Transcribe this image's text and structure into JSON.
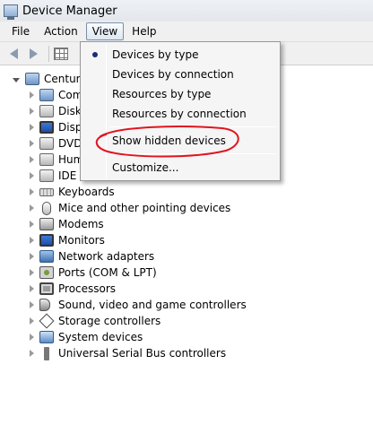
{
  "window": {
    "title": "Device Manager"
  },
  "menubar": {
    "items": [
      "File",
      "Action",
      "View",
      "Help"
    ]
  },
  "tree": {
    "root": "Centurio",
    "items": [
      "Com",
      "Disk",
      "Disp",
      "DVD",
      "Hum",
      "IDE A",
      "Keyboards",
      "Mice and other pointing devices",
      "Modems",
      "Monitors",
      "Network adapters",
      "Ports (COM & LPT)",
      "Processors",
      "Sound, video and game controllers",
      "Storage controllers",
      "System devices",
      "Universal Serial Bus controllers"
    ]
  },
  "view_menu": {
    "items": [
      "Devices by type",
      "Devices by connection",
      "Resources by type",
      "Resources by connection",
      "Show hidden devices",
      "Customize..."
    ],
    "selected_index": 0
  },
  "annotation": {
    "color": "#e0141e"
  }
}
